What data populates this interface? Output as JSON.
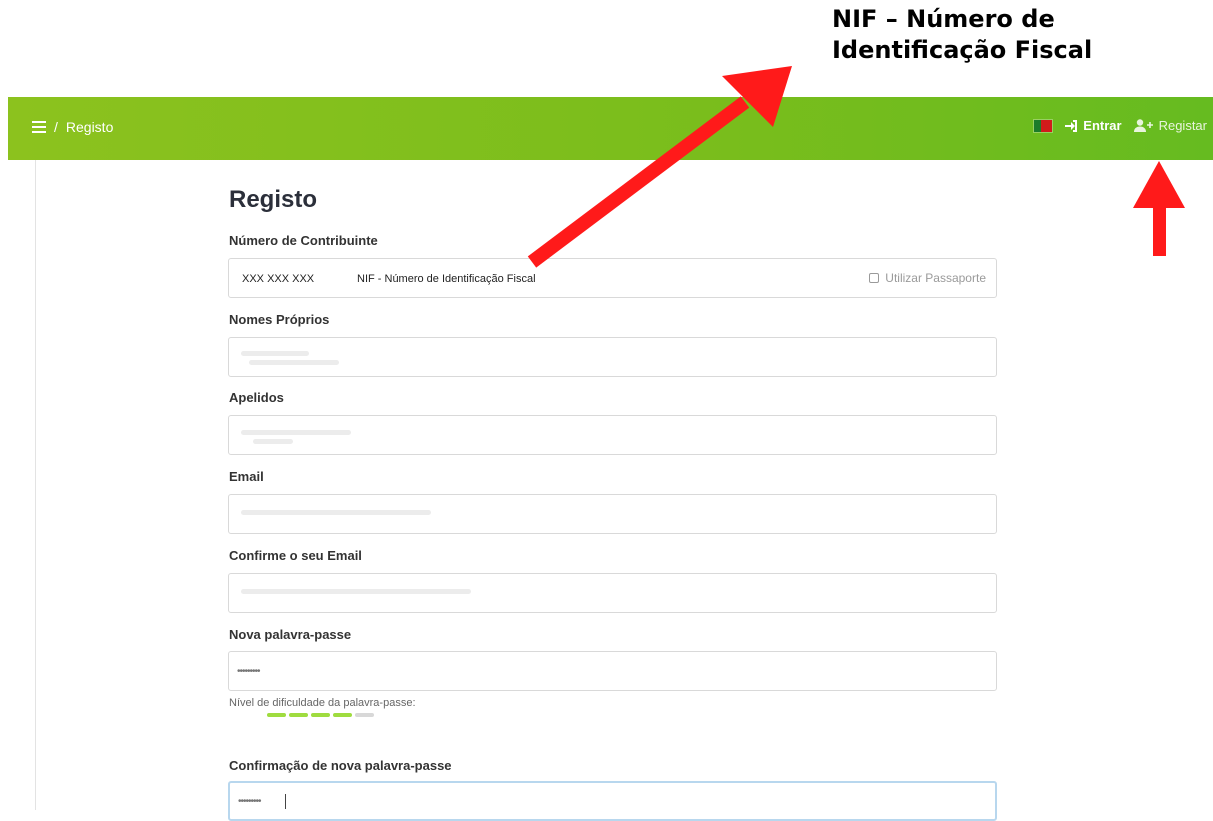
{
  "annotation": {
    "line1": "NIF – Número de",
    "line2": "Identificação Fiscal"
  },
  "topbar": {
    "breadcrumb": "Registo",
    "login_label": "Entrar",
    "register_label": "Registar"
  },
  "form": {
    "title": "Registo",
    "nif": {
      "label": "Número de Contribuinte",
      "value": "XXX XXX XXX",
      "description": "NIF - Número de Identificação Fiscal",
      "passport_label": "Utilizar Passaporte"
    },
    "first_names_label": "Nomes Próprios",
    "surnames_label": "Apelidos",
    "email_label": "Email",
    "confirm_email_label": "Confirme o seu Email",
    "password": {
      "label": "Nova palavra-passe",
      "value": "•••••••••",
      "strength_label": "Nível de dificuldade da palavra-passe:",
      "strength_level": 4,
      "strength_max": 5
    },
    "confirm_password": {
      "label": "Confirmação de nova palavra-passe",
      "value": "•••••••••"
    }
  },
  "colors": {
    "header_green": "#7cbf1d",
    "strength_green": "#9fdc3f",
    "annotation_arrow": "#ff1a1a"
  }
}
